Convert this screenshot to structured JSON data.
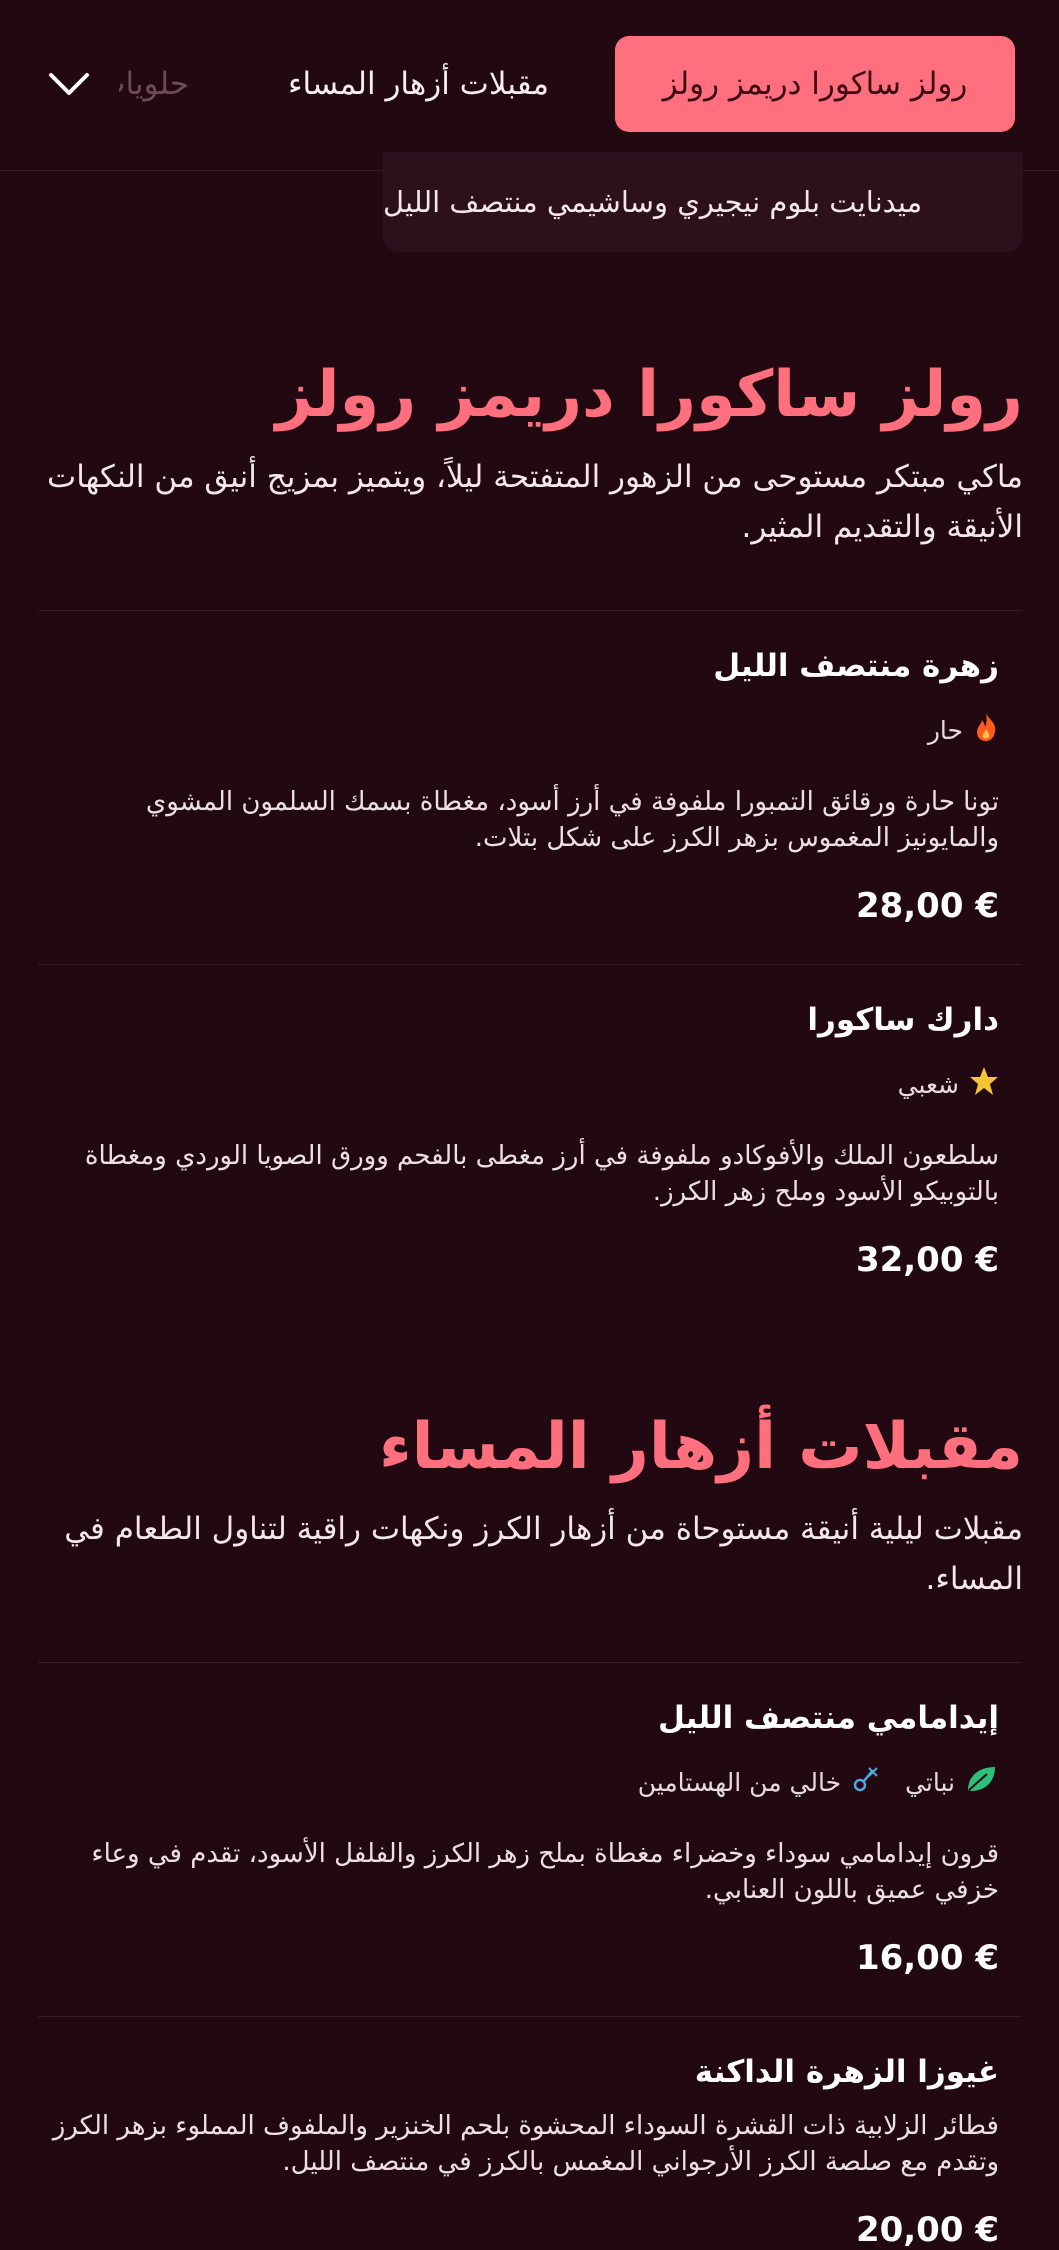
{
  "nav": {
    "tabs": [
      {
        "label": "رولز ساكورا دريمز رولز"
      },
      {
        "label": "مقبلات أزهار المساء"
      },
      {
        "label": "حلويات"
      }
    ],
    "subnav_pill": "ميدنايت بلوم نيجيري وساشيمي منتصف الليل",
    "expand_icon": "chevron-down-icon"
  },
  "sections": [
    {
      "title": "رولز ساكورا دريمز رولز",
      "description": "ماكي مبتكر مستوحى من الزهور المتفتحة ليلاً، ويتميز بمزيج أنيق من النكهات الأنيقة والتقديم المثير.",
      "items": [
        {
          "name": "زهرة منتصف الليل",
          "tags": [
            {
              "icon": "fire-icon",
              "label": "حار"
            }
          ],
          "description": "تونا حارة ورقائق التمبورا ملفوفة في أرز أسود، مغطاة بسمك السلمون المشوي والمايونيز المغموس بزهر الكرز على شكل بتلات.",
          "price": "28,00 €"
        },
        {
          "name": "دارك ساكورا",
          "tags": [
            {
              "icon": "star-icon",
              "label": "شعبي"
            }
          ],
          "description": "سلطعون الملك والأفوكادو ملفوفة في أرز مغطى بالفحم وورق الصويا الوردي ومغطاة بالتوبيكو الأسود وملح زهر الكرز.",
          "price": "32,00 €"
        }
      ]
    },
    {
      "title": "مقبلات أزهار المساء",
      "description": "مقبلات ليلية أنيقة مستوحاة من أزهار الكرز ونكهات راقية لتناول الطعام في المساء.",
      "items": [
        {
          "name": "إيدامامي منتصف الليل",
          "tags": [
            {
              "icon": "vegan-leaf-icon",
              "label": "نباتي"
            },
            {
              "icon": "histamine-free-icon",
              "label": "خالي من الهستامين"
            }
          ],
          "description": "قرون إيدامامي سوداء وخضراء مغطاة بملح زهر الكرز والفلفل الأسود، تقدم في وعاء خزفي عميق باللون العنابي.",
          "price": "16,00 €"
        },
        {
          "name": "غيوزا الزهرة الداكنة",
          "tags": [],
          "description": "فطائر الزلابية ذات القشرة السوداء المحشوة بلحم الخنزير والملفوف المملوء بزهر الكرز وتقدم مع صلصة الكرز الأرجواني المغمس بالكرز في منتصف الليل.",
          "price": "20,00 €"
        }
      ]
    }
  ],
  "colors": {
    "background": "#210811",
    "accent": "#ff6f7d",
    "text": "#f1e6ea"
  }
}
